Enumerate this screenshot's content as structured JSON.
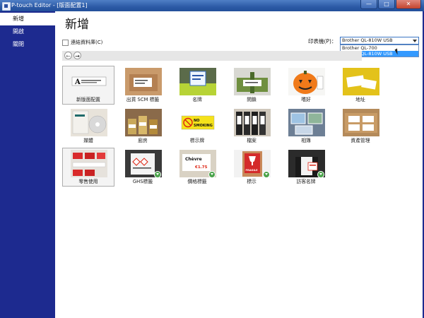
{
  "window": {
    "title": "P-touch Editor - [版面配置1]",
    "buttons": [
      "—",
      "□",
      "✕"
    ]
  },
  "sidebar": {
    "items": [
      {
        "label": "新增"
      },
      {
        "label": "開啟"
      },
      {
        "label": "關閉"
      }
    ]
  },
  "main": {
    "title": "新增",
    "db_checkbox_label": "連結資料庫(C)",
    "printer_label": "印表機(P)：",
    "printer_selected": "Brother QL-810W USB",
    "printer_options": [
      "Brother QL-700",
      "Brother QL-810W USB"
    ],
    "back_glyph": "←",
    "forward_glyph": "→"
  },
  "tiles": [
    {
      "label": "新版面配置"
    },
    {
      "label": "出貨 SCM 標籤"
    },
    {
      "label": "名牌"
    },
    {
      "label": "開鎖"
    },
    {
      "label": "嗜好"
    },
    {
      "label": "地址"
    },
    {
      "label": "媒體"
    },
    {
      "label": "廚房"
    },
    {
      "label": "標示牌"
    },
    {
      "label": "檔案"
    },
    {
      "label": "相簿"
    },
    {
      "label": "資產管理"
    },
    {
      "label": "零售使用"
    },
    {
      "label": "GHS標籤"
    },
    {
      "label": "價格標籤"
    },
    {
      "label": "標示"
    },
    {
      "label": "訪客名牌"
    }
  ],
  "thumb_text": {
    "no_smoking_line1": "NO",
    "no_smoking_line2": "SMOKING",
    "price_word": "Chèvre",
    "price_value": "€1.75",
    "warning_word": "FRAGILE"
  }
}
